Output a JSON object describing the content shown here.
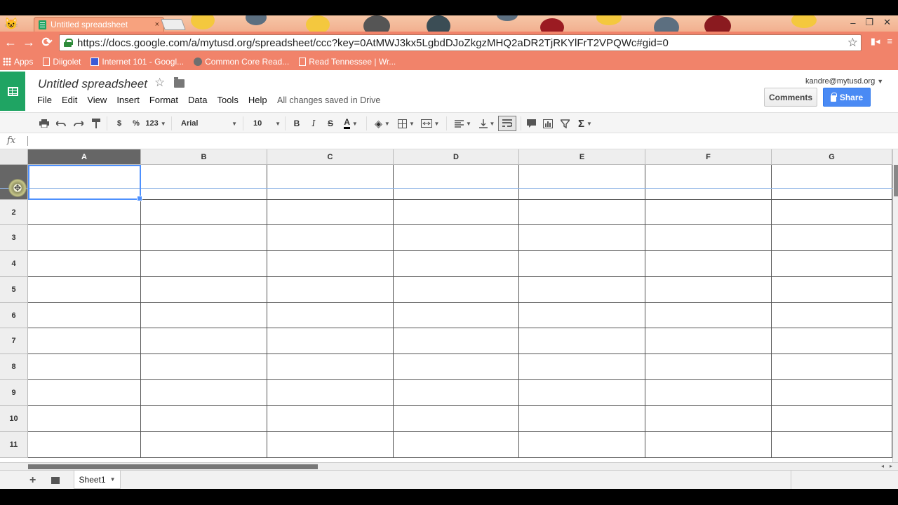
{
  "browser": {
    "tab_title": "Untitled spreadsheet",
    "tab_close": "×",
    "url": "https://docs.google.com/a/mytusd.org/spreadsheet/ccc?key=0AtMWJ3kx5LgbdDJoZkgzMHQ2aDR2TjRKYlFrT2VPQWc#gid=0",
    "window_controls": [
      "–",
      "❐",
      "✕"
    ],
    "nav": {
      "back": "←",
      "forward": "→",
      "reload": "⟳"
    },
    "bookmarks": [
      {
        "label": "Apps",
        "icon": "apps-icon"
      },
      {
        "label": "Diigolet",
        "icon": "page-icon"
      },
      {
        "label": "Internet 101 - Googl...",
        "icon": "bookmark-doc-icon"
      },
      {
        "label": "Common Core Read...",
        "icon": "globe-icon"
      },
      {
        "label": "Read Tennessee | Wr...",
        "icon": "page-icon"
      }
    ]
  },
  "docs": {
    "title": "Untitled spreadsheet",
    "menu": [
      "File",
      "Edit",
      "View",
      "Insert",
      "Format",
      "Data",
      "Tools",
      "Help"
    ],
    "save_status": "All changes saved in Drive",
    "account": "kandre@mytusd.org",
    "comments_label": "Comments",
    "share_label": "Share",
    "accent_color": "#1fa463",
    "share_color": "#4a8af4"
  },
  "toolbar": {
    "currency": "$",
    "percent": "%",
    "number_format": "123",
    "font": "Arial",
    "font_size": "10",
    "bold": "B",
    "italic": "I",
    "strike": "S",
    "text_color": "A",
    "sigma": "Σ"
  },
  "formula_bar": {
    "fx_label": "fx",
    "value": ""
  },
  "grid": {
    "columns": [
      "A",
      "B",
      "C",
      "D",
      "E",
      "F",
      "G"
    ],
    "rows": [
      "1",
      "2",
      "3",
      "4",
      "5",
      "6",
      "7",
      "8",
      "9",
      "10",
      "11"
    ],
    "selected_cell": "A1"
  },
  "sheets": {
    "add": "+",
    "tabs": [
      {
        "label": "Sheet1",
        "active": true
      }
    ]
  }
}
